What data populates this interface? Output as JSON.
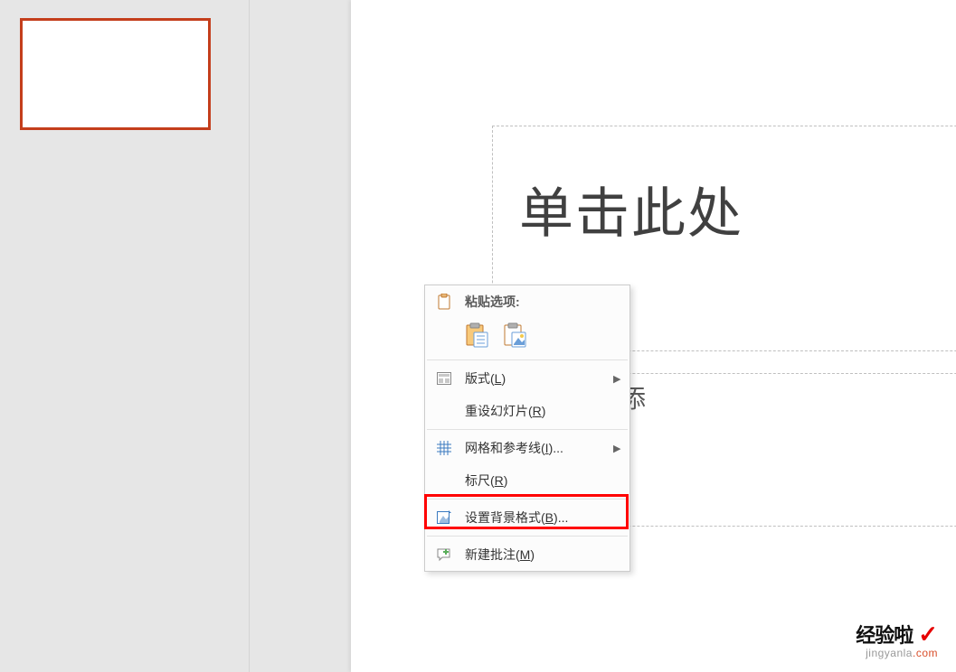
{
  "slide": {
    "title_placeholder": "单击此处",
    "subtitle_placeholder": "单击此处添"
  },
  "context_menu": {
    "paste_options_label": "粘贴选项:",
    "layout": {
      "label": "版式",
      "hotkey": "L"
    },
    "reset_slide": {
      "label": "重设幻灯片",
      "hotkey": "R"
    },
    "grid_guides": {
      "label": "网格和参考线",
      "hotkey": "I",
      "ellipsis": "..."
    },
    "ruler": {
      "label": "标尺",
      "hotkey": "R"
    },
    "format_background": {
      "label": "设置背景格式",
      "hotkey": "B",
      "ellipsis": "..."
    },
    "new_comment": {
      "label": "新建批注",
      "hotkey": "M"
    }
  },
  "watermark": {
    "line1": "经验啦",
    "line2_a": "jingyanla",
    "line2_b": ".com"
  },
  "icons": {
    "clipboard": "clipboard-icon",
    "paste_keep": "paste-keep-formatting-icon",
    "paste_picture": "paste-as-picture-icon",
    "layout": "layout-icon",
    "grid": "grid-icon",
    "format_bg": "format-background-icon",
    "comment": "new-comment-icon"
  }
}
